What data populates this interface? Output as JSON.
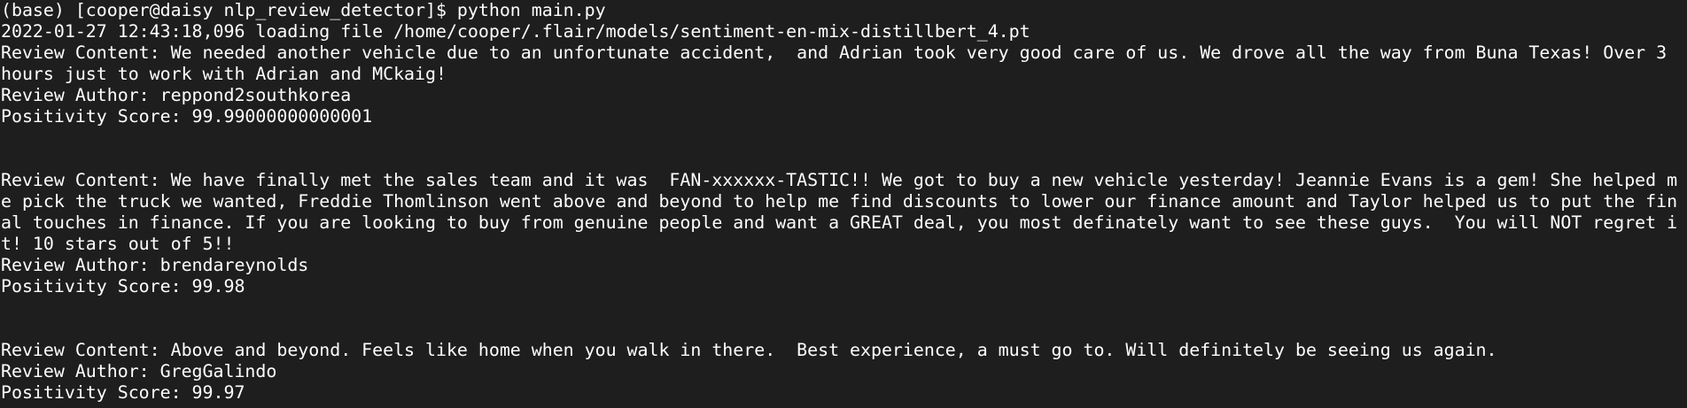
{
  "terminal": {
    "prompt": "(base) [cooper@daisy nlp_review_detector]$ python main.py",
    "log_line": "2022-01-27 12:43:18,096 loading file /home/cooper/.flair/models/sentiment-en-mix-distillbert_4.pt",
    "reviews": [
      {
        "content_lines": [
          "Review Content: We needed another vehicle due to an unfortunate accident,  and Adrian took very good care of us. We drove all the way from Buna Texas! Over 3",
          "hours just to work with Adrian and MCkaig!"
        ],
        "author": "Review Author: reppond2southkorea",
        "score": "Positivity Score: 99.99000000000001"
      },
      {
        "content_lines": [
          "Review Content: We have finally met the sales team and it was  FAN-xxxxxx-TASTIC!! We got to buy a new vehicle yesterday! Jeannie Evans is a gem! She helped m",
          "e pick the truck we wanted, Freddie Thomlinson went above and beyond to help me find discounts to lower our finance amount and Taylor helped us to put the fin",
          "al touches in finance. If you are looking to buy from genuine people and want a GREAT deal, you most definately want to see these guys.  You will NOT regret i",
          "t! 10 stars out of 5!!"
        ],
        "author": "Review Author: brendareynolds",
        "score": "Positivity Score: 99.98"
      },
      {
        "content_lines": [
          "Review Content: Above and beyond. Feels like home when you walk in there.  Best experience, a must go to. Will definitely be seeing us again."
        ],
        "author": "Review Author: GregGalindo",
        "score": "Positivity Score: 99.97"
      }
    ]
  }
}
